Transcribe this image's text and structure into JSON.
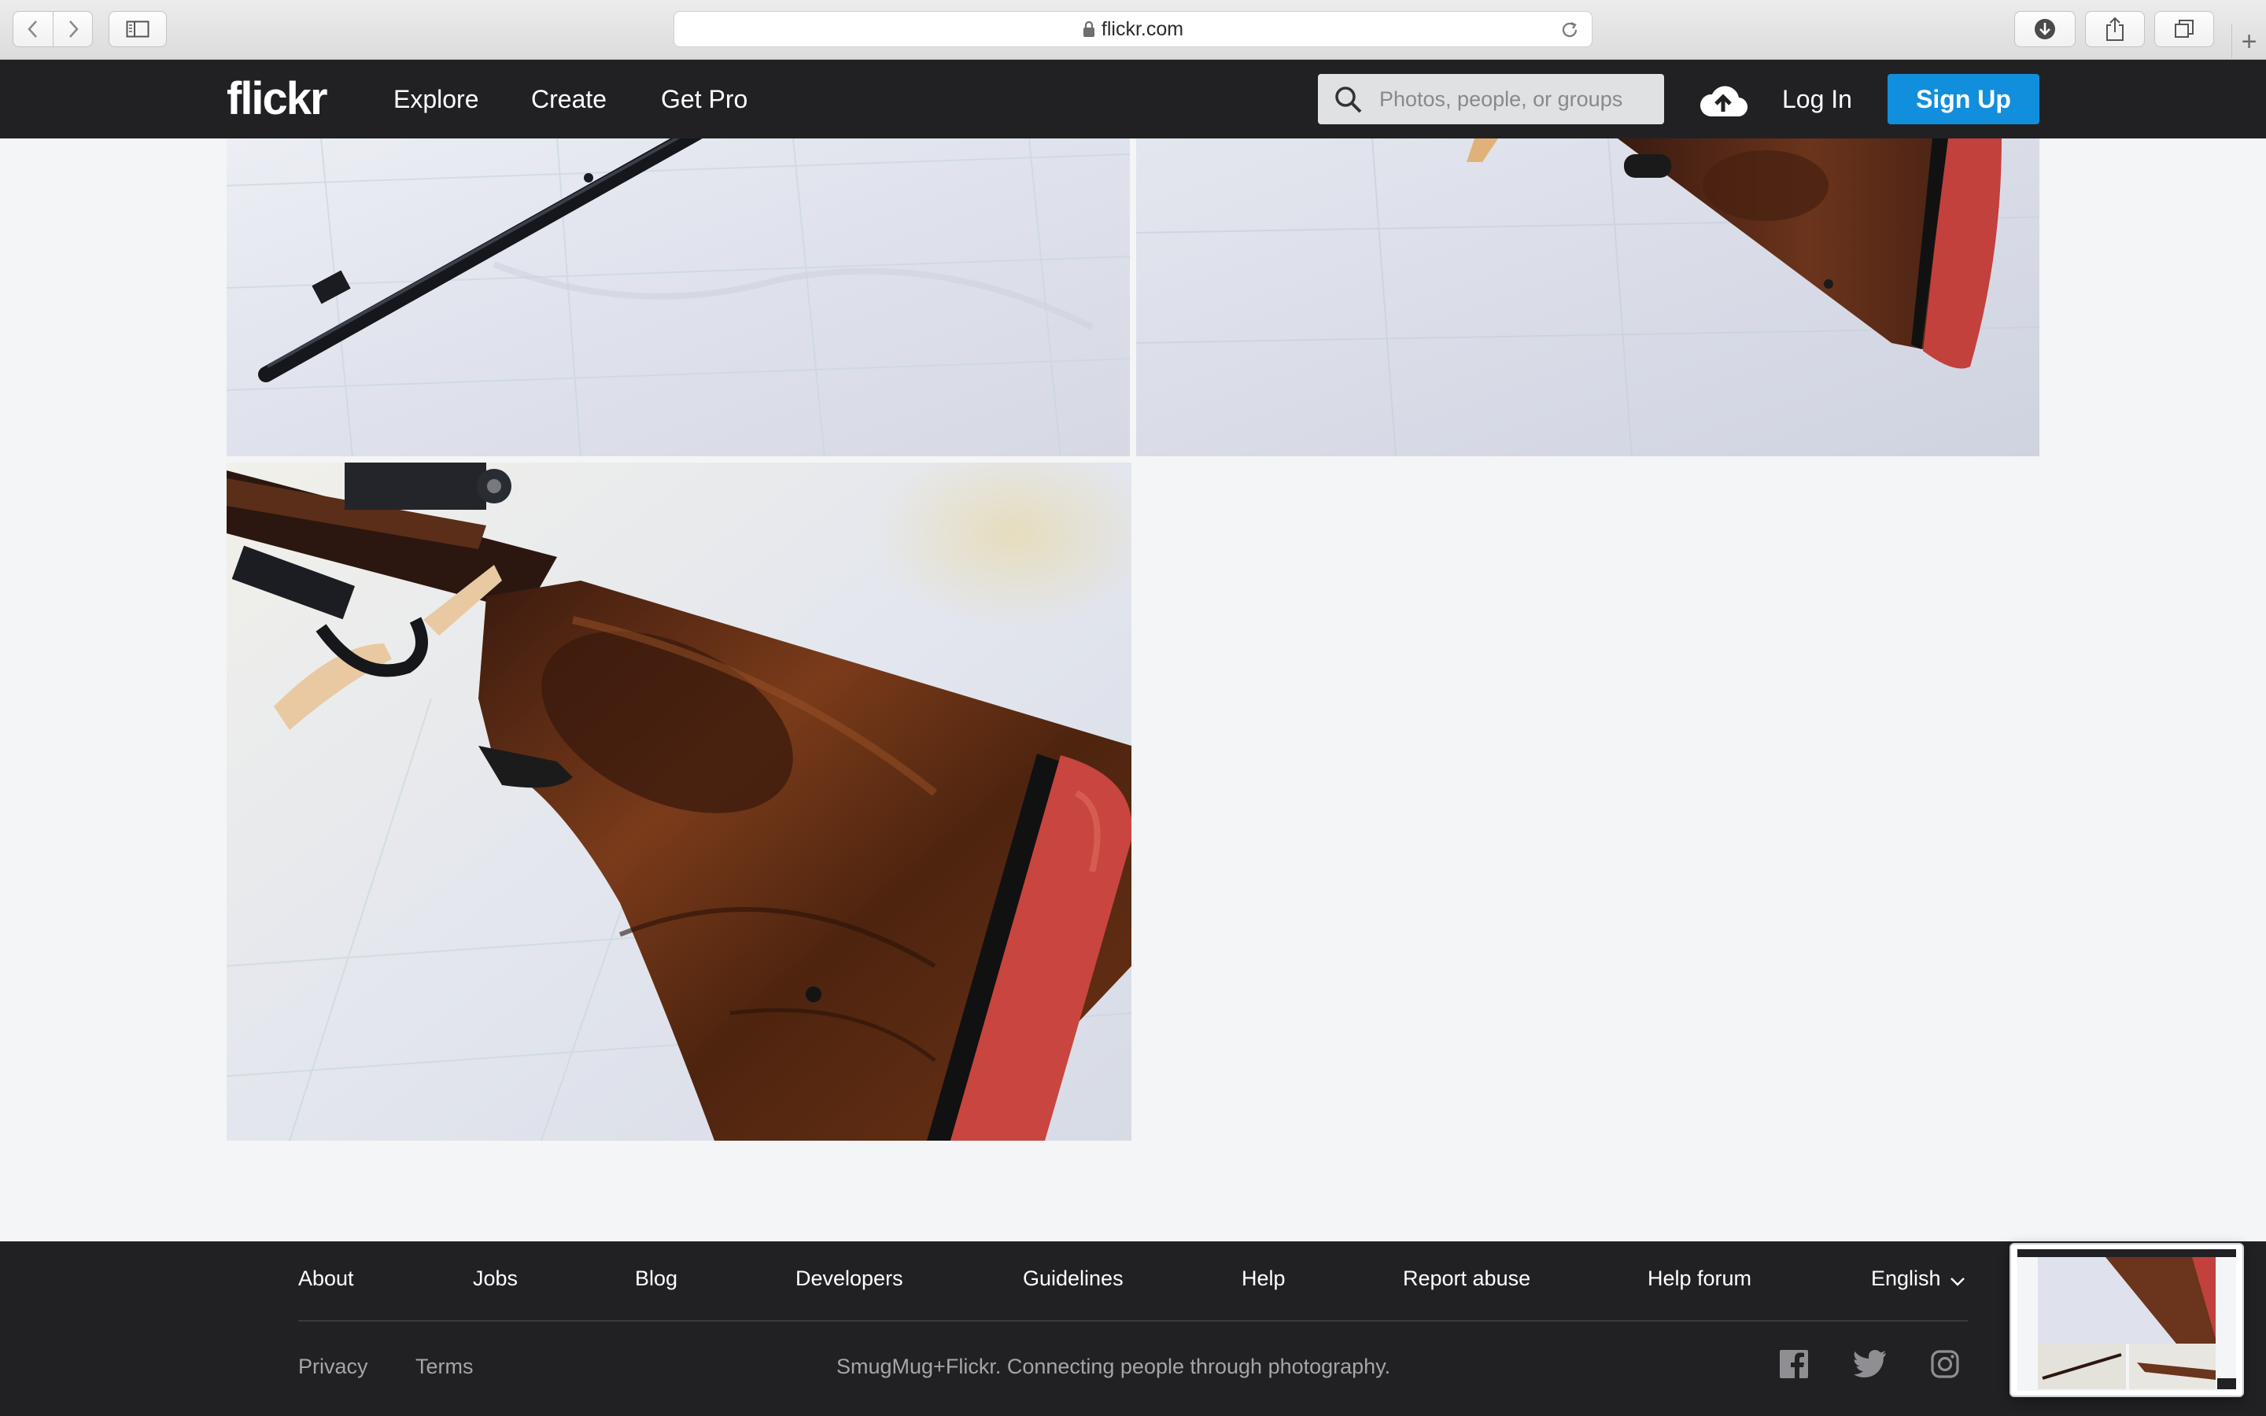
{
  "browser": {
    "url": "flickr.com",
    "icons": [
      "chevron-left-icon",
      "chevron-right-icon",
      "sidebar-icon",
      "lock-icon",
      "reload-icon",
      "download-icon",
      "share-icon",
      "tabs-icon",
      "plus-icon"
    ]
  },
  "header": {
    "logo": "flickr",
    "nav": [
      "Explore",
      "Create",
      "Get Pro"
    ],
    "search_placeholder": "Photos, people, or groups",
    "login": "Log In",
    "signup": "Sign Up",
    "accent_color": "#128fdc",
    "background_color": "#212124"
  },
  "photos": [
    {
      "subject": "rifle barrel"
    },
    {
      "subject": "rifle stock with red recoil pad"
    },
    {
      "subject": "rifle stock close-up"
    }
  ],
  "footer": {
    "links": [
      "About",
      "Jobs",
      "Blog",
      "Developers",
      "Guidelines",
      "Help",
      "Report abuse",
      "Help forum"
    ],
    "language": "English",
    "sub_links": [
      "Privacy",
      "Terms"
    ],
    "tagline": "SmugMug+Flickr. Connecting people through photography.",
    "social_icons": [
      "facebook-icon",
      "twitter-icon",
      "instagram-icon"
    ]
  }
}
